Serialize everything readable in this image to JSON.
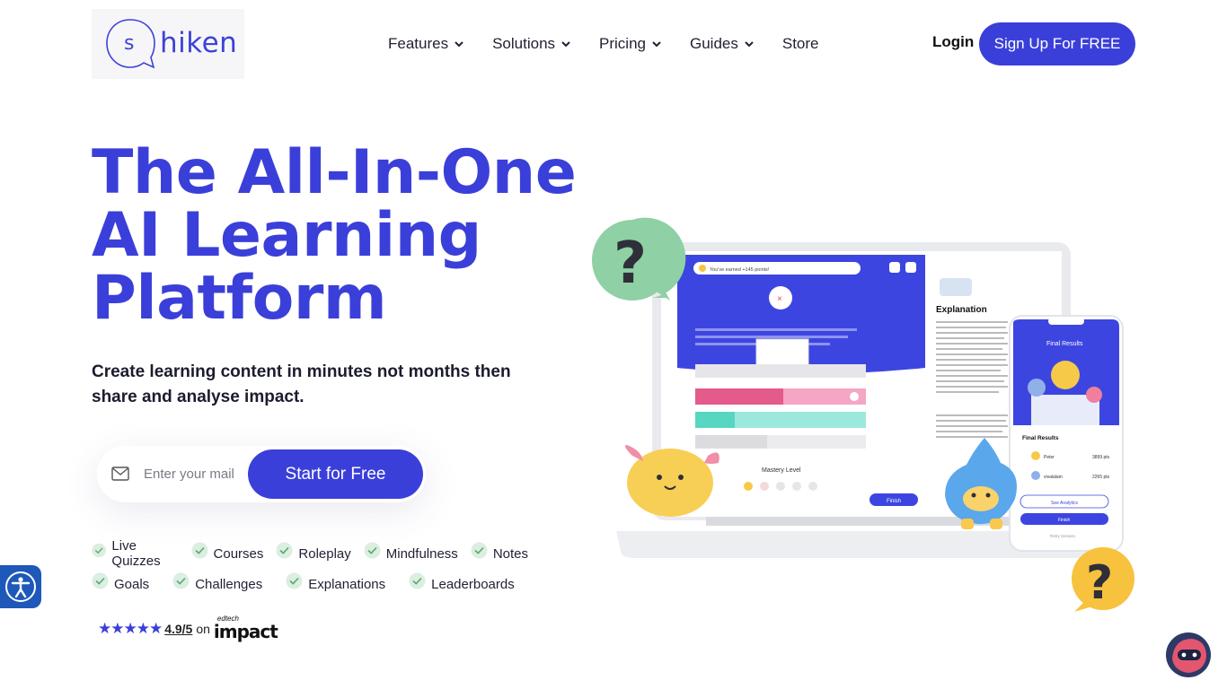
{
  "header": {
    "logo_letter": "s",
    "logo_text": "hiken",
    "nav": [
      {
        "label": "Features",
        "dropdown": true
      },
      {
        "label": "Solutions",
        "dropdown": true
      },
      {
        "label": "Pricing",
        "dropdown": true
      },
      {
        "label": "Guides",
        "dropdown": true
      },
      {
        "label": "Store",
        "dropdown": false
      }
    ],
    "login_label": "Login",
    "signup_label": "Sign Up For FREE"
  },
  "hero": {
    "title_line1": "The All-In-One",
    "title_line2": "AI Learning",
    "title_line3": "Platform",
    "subtitle": "Create learning content in minutes not months then share and analyse impact.",
    "email_placeholder": "Enter your mail",
    "cta_label": "Start for Free"
  },
  "features": {
    "row1": [
      "Live Quizzes",
      "Courses",
      "Roleplay",
      "Mindfulness",
      "Notes"
    ],
    "row2": [
      "Goals",
      "Challenges",
      "Explanations",
      "Leaderboards"
    ]
  },
  "rating": {
    "stars": "★★★★★",
    "score": "4.9/5",
    "on": "on",
    "brand_small": "edtech",
    "brand_big": "impact"
  },
  "mockup": {
    "toast": "You've earned +145 points!",
    "explanation_title": "Explanation",
    "mastery_label": "Mastery Level",
    "finish_label": "Finish",
    "phone_header": "Final Results",
    "phone_results_title": "Final Results",
    "players": [
      {
        "name": "Peter",
        "pts": "3899 pts"
      },
      {
        "name": "vivalalam",
        "pts": "2265 pts"
      }
    ],
    "see_analytics": "See Analytics",
    "finish_phone": "Finish",
    "retry": "Retry Session"
  },
  "colors": {
    "brand": "#3b3fd9",
    "check_green": "#a8dcb9",
    "a11y_blue": "#1e58b9"
  }
}
